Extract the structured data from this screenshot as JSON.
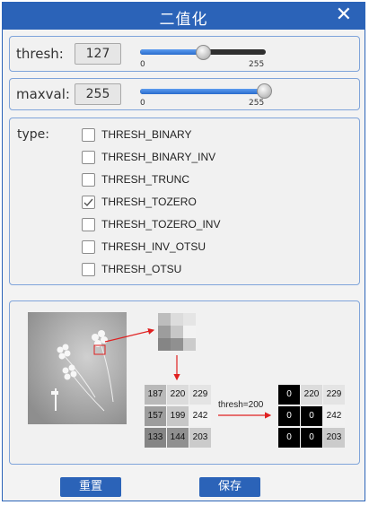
{
  "window": {
    "title": "二值化",
    "close_glyph": "✕"
  },
  "thresh": {
    "label": "thresh:",
    "value": "127",
    "min": "0",
    "max": "255",
    "fraction": 0.5
  },
  "maxval": {
    "label": "maxval:",
    "value": "255",
    "min": "0",
    "max": "255",
    "fraction": 1.0
  },
  "type": {
    "label": "type:",
    "options": [
      {
        "label": "THRESH_BINARY",
        "checked": false
      },
      {
        "label": "THRESH_BINARY_INV",
        "checked": false
      },
      {
        "label": "THRESH_TRUNC",
        "checked": false
      },
      {
        "label": "THRESH_TOZERO",
        "checked": true
      },
      {
        "label": "THRESH_TOZERO_INV",
        "checked": false
      },
      {
        "label": "THRESH_INV_OTSU",
        "checked": false
      },
      {
        "label": "THRESH_OTSU",
        "checked": false
      }
    ]
  },
  "illustration": {
    "arrow_label": "thresh=200",
    "source_grid": [
      [
        "187",
        "220",
        "229"
      ],
      [
        "157",
        "199",
        "242"
      ],
      [
        "133",
        "144",
        "203"
      ]
    ],
    "result_grid": [
      [
        "0",
        "220",
        "229"
      ],
      [
        "0",
        "0",
        "242"
      ],
      [
        "0",
        "0",
        "203"
      ]
    ],
    "accent_color": "#e02020"
  },
  "buttons": {
    "reset": "重置",
    "save": "保存"
  },
  "colors": {
    "brand": "#2b63b8"
  }
}
